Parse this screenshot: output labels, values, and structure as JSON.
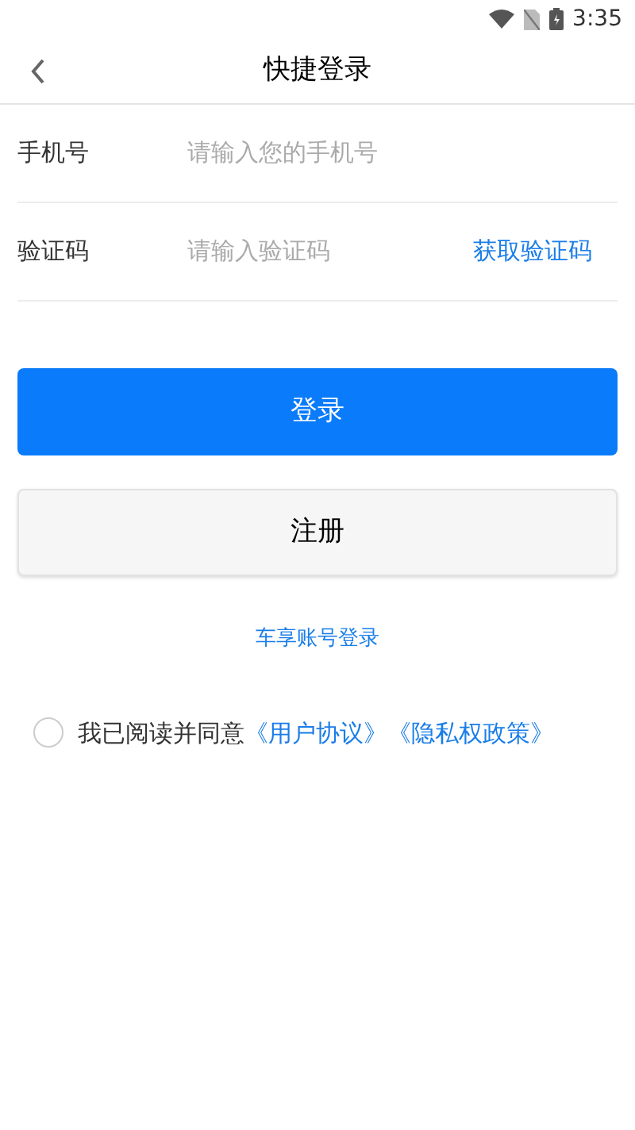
{
  "status_bar": {
    "time": "3:35"
  },
  "header": {
    "title": "快捷登录"
  },
  "fields": [
    {
      "label": "手机号",
      "placeholder": "请输入您的手机号"
    },
    {
      "label": "验证码",
      "placeholder": "请输入验证码",
      "action": "获取验证码"
    }
  ],
  "buttons": [
    {
      "label": "登录",
      "kind": "primary"
    },
    {
      "label": "注册",
      "kind": "secondary"
    }
  ],
  "alt_login_link": "车享账号登录",
  "agreement": {
    "checked": false,
    "text": "我已阅读并同意",
    "links": [
      "《用户协议》",
      "《隐私权政策》"
    ]
  }
}
